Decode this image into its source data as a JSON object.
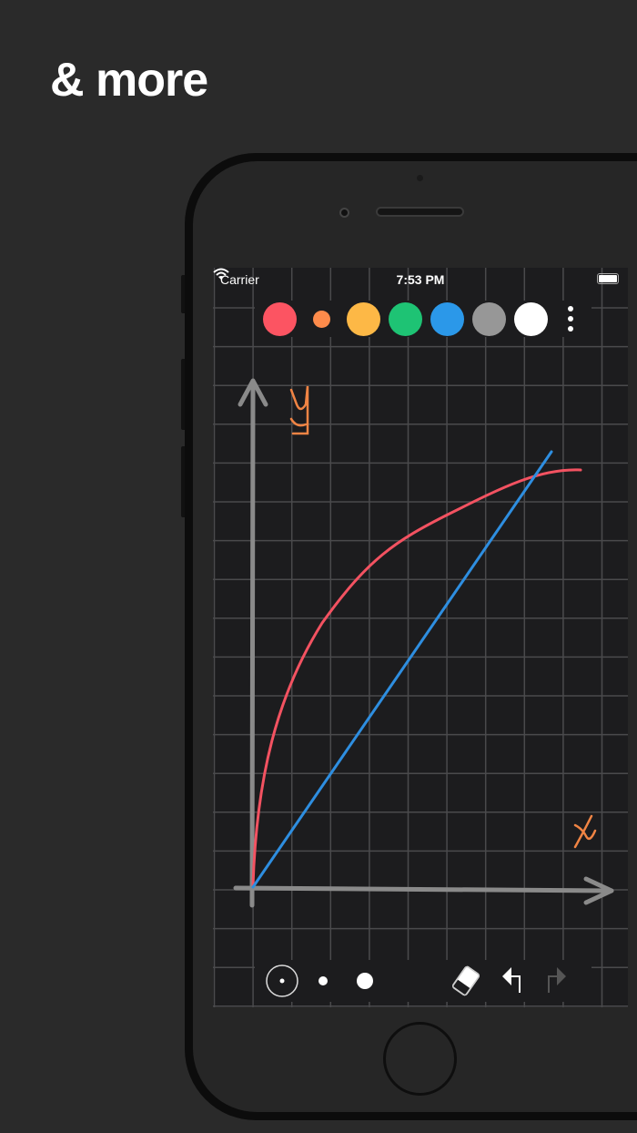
{
  "headline": "& more",
  "status_bar": {
    "carrier": "Carrier",
    "time": "7:53 PM"
  },
  "palette": {
    "colors": [
      "#fc5462",
      "#fd8b4b",
      "#fdb846",
      "#1ec374",
      "#2b98e9",
      "#979797",
      "#ffffff"
    ],
    "selected_index": 1
  },
  "canvas": {
    "axis_label_y": "y",
    "axis_label_x": "x",
    "axis_color": "#8a8a8a",
    "curve_color": "#f35261",
    "line_color": "#2e8ee0",
    "label_color": "#f08444"
  },
  "toolbar": {
    "tools": [
      "brush-size-small-selected",
      "brush-size-medium",
      "brush-size-large",
      "eraser",
      "undo",
      "redo"
    ]
  }
}
